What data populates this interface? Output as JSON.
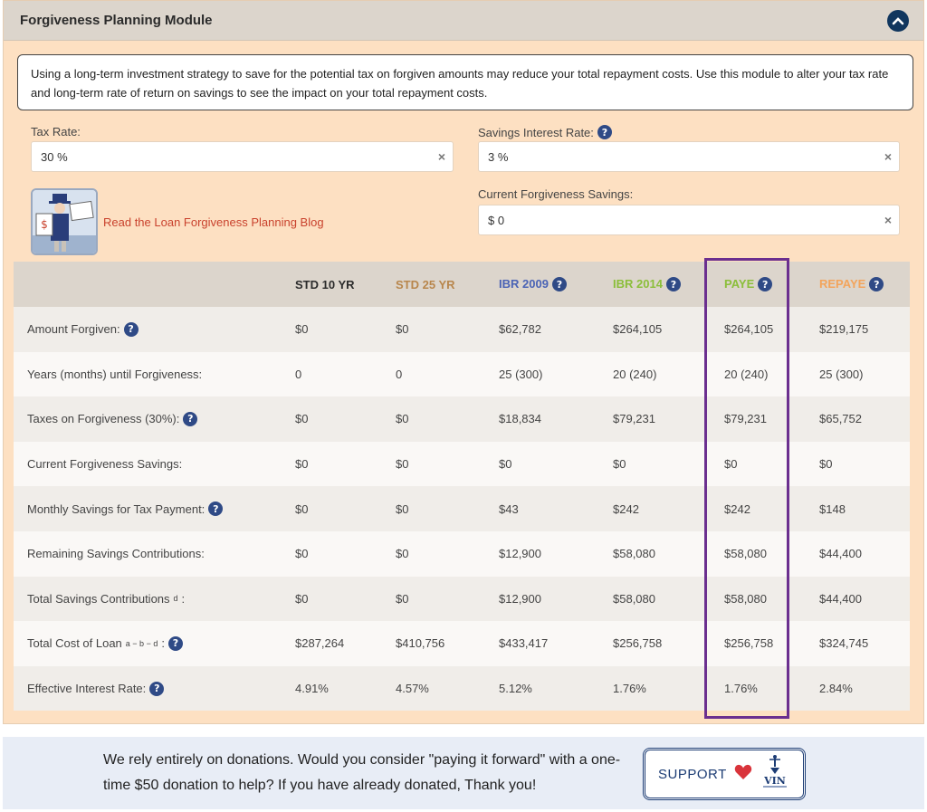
{
  "header": {
    "title": "Forgiveness Planning Module"
  },
  "intro": "Using a long-term investment strategy to save for the potential tax on forgiven amounts may reduce your total repayment costs. Use this module to alter your tax rate and long-term rate of return on savings to see the impact on your total repayment costs.",
  "fields": {
    "tax_rate": {
      "label": "Tax Rate:",
      "value": "30 %"
    },
    "savings_rate": {
      "label": "Savings Interest Rate:",
      "value": "3 %"
    },
    "current_savings": {
      "label": "Current Forgiveness Savings:",
      "value": "$ 0"
    }
  },
  "blog": {
    "link": "Read the Loan Forgiveness Planning Blog"
  },
  "table": {
    "columns": [
      {
        "label": "STD 10 YR",
        "color": "#2b2b2b",
        "help": false
      },
      {
        "label": "STD 25 YR",
        "color": "#b8864c",
        "help": false
      },
      {
        "label": "IBR 2009",
        "color": "#4a63b5",
        "help": true
      },
      {
        "label": "IBR 2014",
        "color": "#8bbe3a",
        "help": true
      },
      {
        "label": "PAYE",
        "color": "#8bbe3a",
        "help": true
      },
      {
        "label": "REPAYE",
        "color": "#f3a45b",
        "help": true
      }
    ],
    "rows": [
      {
        "label": "Amount Forgiven:",
        "sup": "",
        "help": true,
        "values": [
          "$0",
          "$0",
          "$62,782",
          "$264,105",
          "$264,105",
          "$219,175"
        ]
      },
      {
        "label": "Years (months) until Forgiveness:",
        "sup": "",
        "help": false,
        "values": [
          "0",
          "0",
          "25 (300)",
          "20 (240)",
          "20 (240)",
          "25 (300)"
        ]
      },
      {
        "label": "Taxes on Forgiveness (30%):",
        "sup": "",
        "help": true,
        "values": [
          "$0",
          "$0",
          "$18,834",
          "$79,231",
          "$79,231",
          "$65,752"
        ]
      },
      {
        "label": "Current Forgiveness Savings:",
        "sup": "",
        "help": false,
        "values": [
          "$0",
          "$0",
          "$0",
          "$0",
          "$0",
          "$0"
        ]
      },
      {
        "label": "Monthly Savings for Tax Payment:",
        "sup": "",
        "help": true,
        "values": [
          "$0",
          "$0",
          "$43",
          "$242",
          "$242",
          "$148"
        ]
      },
      {
        "label": "Remaining Savings Contributions:",
        "sup": "",
        "help": false,
        "values": [
          "$0",
          "$0",
          "$12,900",
          "$58,080",
          "$58,080",
          "$44,400"
        ]
      },
      {
        "label": "Total Savings Contributions",
        "sup": "d",
        "suffix": ":",
        "help": false,
        "values": [
          "$0",
          "$0",
          "$12,900",
          "$58,080",
          "$58,080",
          "$44,400"
        ]
      },
      {
        "label": "Total Cost of Loan",
        "sup": "a − b − d",
        "suffix": ":",
        "help": true,
        "values": [
          "$287,264",
          "$410,756",
          "$433,417",
          "$256,758",
          "$256,758",
          "$324,745"
        ]
      },
      {
        "label": "Effective Interest Rate:",
        "sup": "",
        "help": true,
        "values": [
          "4.91%",
          "4.57%",
          "5.12%",
          "1.76%",
          "1.76%",
          "2.84%"
        ]
      }
    ]
  },
  "donate": {
    "text": "We rely entirely on donations. Would you consider \"paying it forward\" with a one-time $50 donation to help? If you have already donated, Thank you!",
    "button": "SUPPORT"
  },
  "colors": {
    "header_bg": "#dcd5cc",
    "panel_bg": "#fde0c2",
    "help_icon": "#2f4a86",
    "highlight": "#6b2f8f",
    "link": "#c9422d"
  },
  "icons": {
    "collapse": "chevron-up-icon",
    "help": "question-icon",
    "clear": "close-icon",
    "heart": "heart-icon"
  }
}
